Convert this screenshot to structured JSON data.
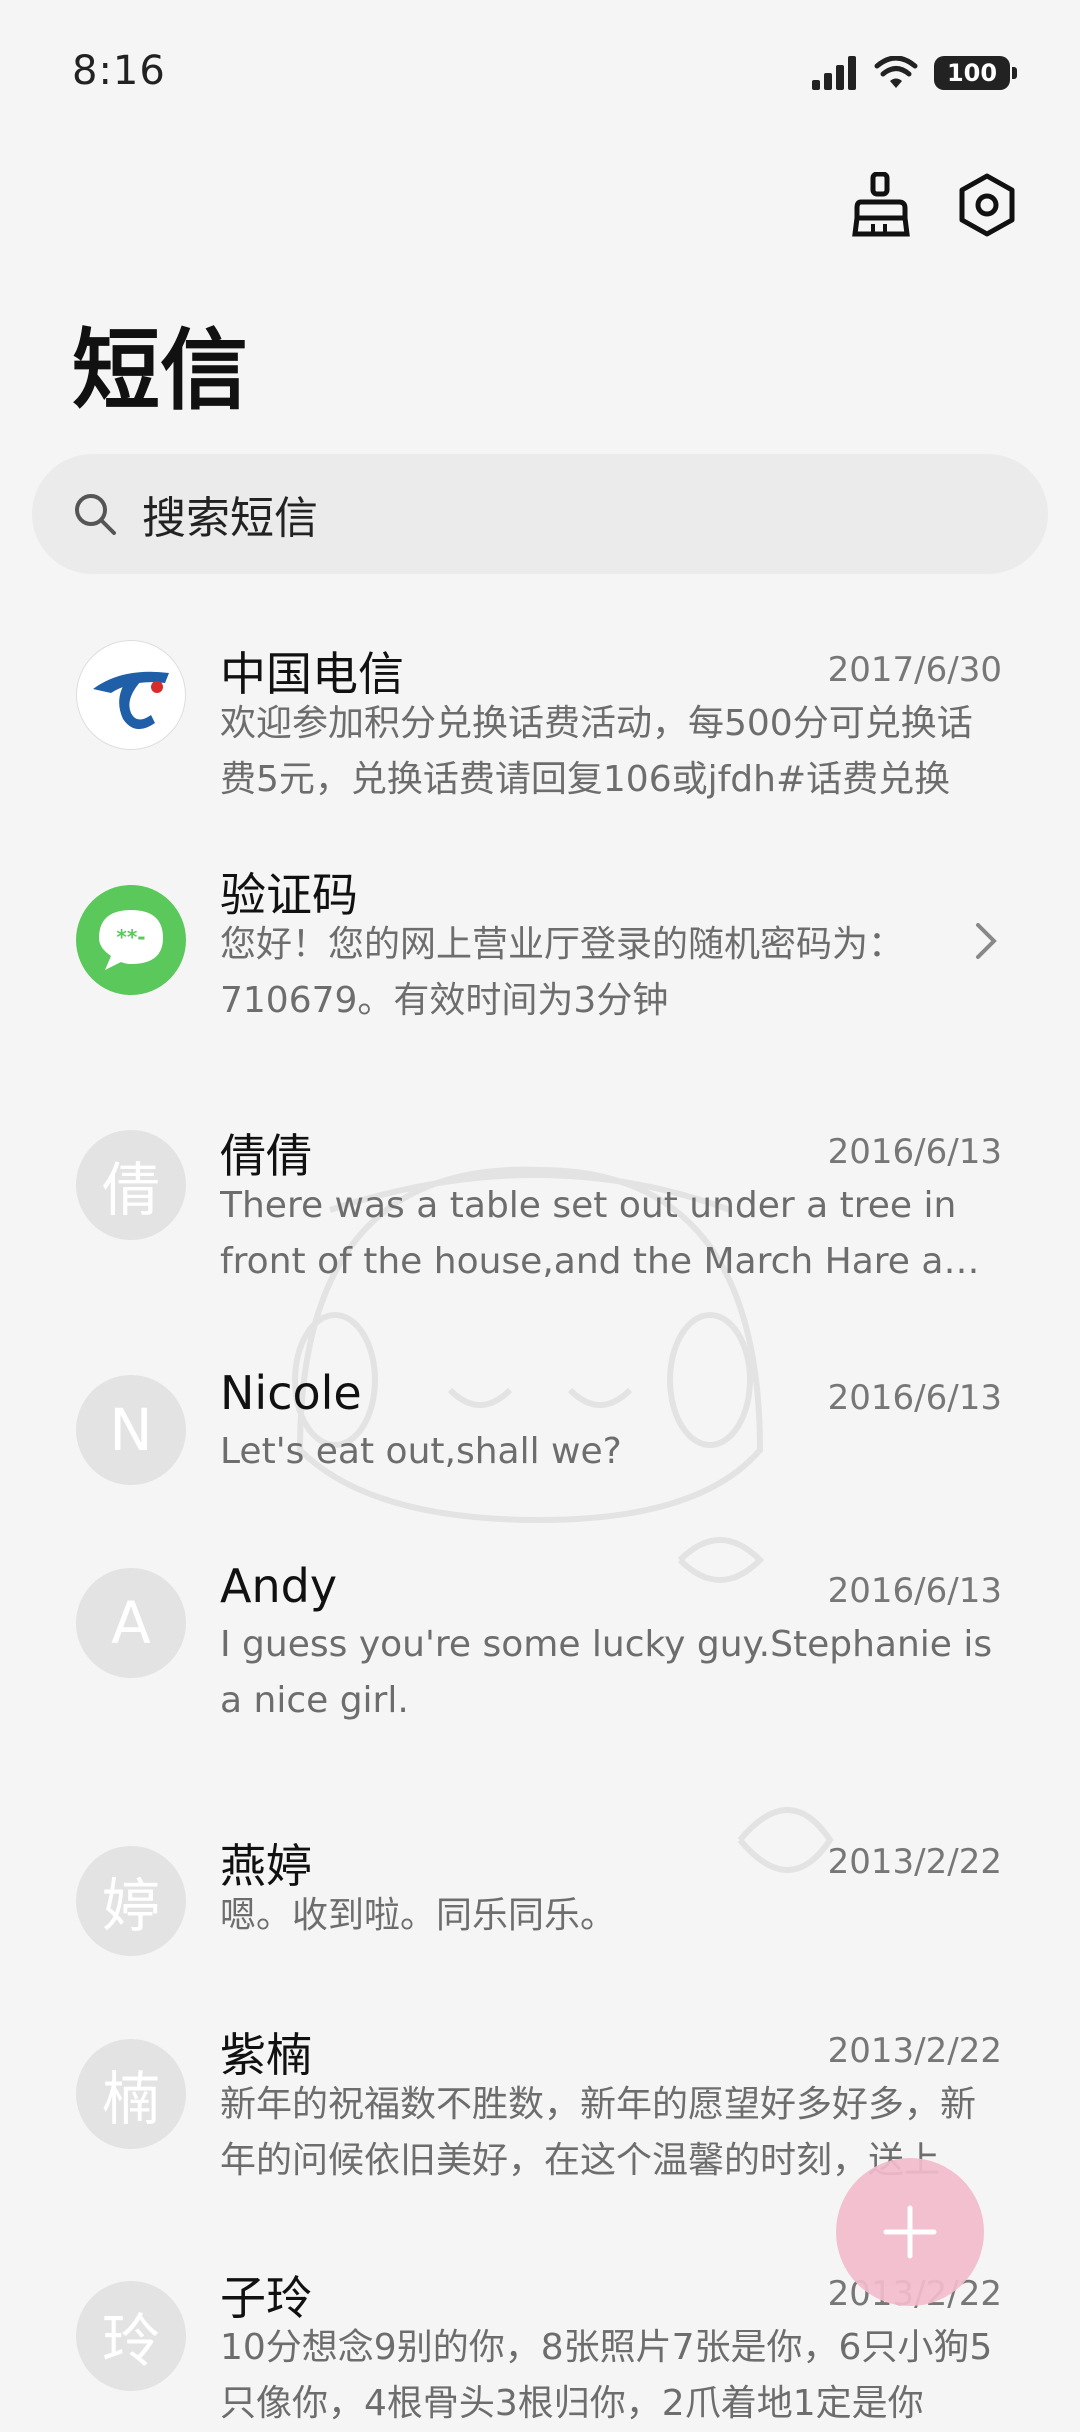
{
  "status_bar": {
    "time": "8:16",
    "battery": "100",
    "icons": [
      "signal-icon",
      "wifi-icon",
      "battery-icon"
    ]
  },
  "toolbar": {
    "icons": [
      "clean-brush-icon",
      "settings-hexagon-icon"
    ]
  },
  "page": {
    "title": "短信"
  },
  "search": {
    "placeholder": "搜索短信"
  },
  "conversations": [
    {
      "name": "中国电信",
      "date": "2017/6/30",
      "preview": "欢迎参加积分兑换话费活动，每500分可兑换话费5元，兑换话费请回复106或jfdh#话费兑换",
      "avatar": "china-telecom-logo"
    },
    {
      "name": "验证码",
      "date": "",
      "preview": "您好！您的网上营业厅登录的随机密码为：710679。有效时间为3分钟",
      "avatar": "verification-code-icon"
    },
    {
      "name": "倩倩",
      "date": "2016/6/13",
      "preview": "There was a table set out under a tree in front of the house,and the March Hare and the Hatter",
      "avatar_letter": "倩"
    },
    {
      "name": "Nicole",
      "date": "2016/6/13",
      "preview": "Let's eat out,shall we?",
      "avatar_letter": "N"
    },
    {
      "name": "Andy",
      "date": "2016/6/13",
      "preview": "I guess you're some lucky guy.Stephanie is a nice girl.",
      "avatar_letter": "A"
    },
    {
      "name": "燕婷",
      "date": "2013/2/22",
      "preview": "嗯。收到啦。同乐同乐。",
      "avatar_letter": "婷"
    },
    {
      "name": "紫楠",
      "date": "2013/2/22",
      "preview": "新年的祝福数不胜数，新年的愿望好多好多，新年的问候依旧美好，在这个温馨的时刻，送上",
      "avatar_letter": "楠"
    },
    {
      "name": "子玲",
      "date": "2013/2/22",
      "preview": "10分想念9别的你，8张照片7张是你，6只小狗5只像你，4根骨头3根归你，2爪着地1定是你",
      "avatar_letter": "玲"
    }
  ],
  "fab": {
    "icon": "plus-icon"
  }
}
